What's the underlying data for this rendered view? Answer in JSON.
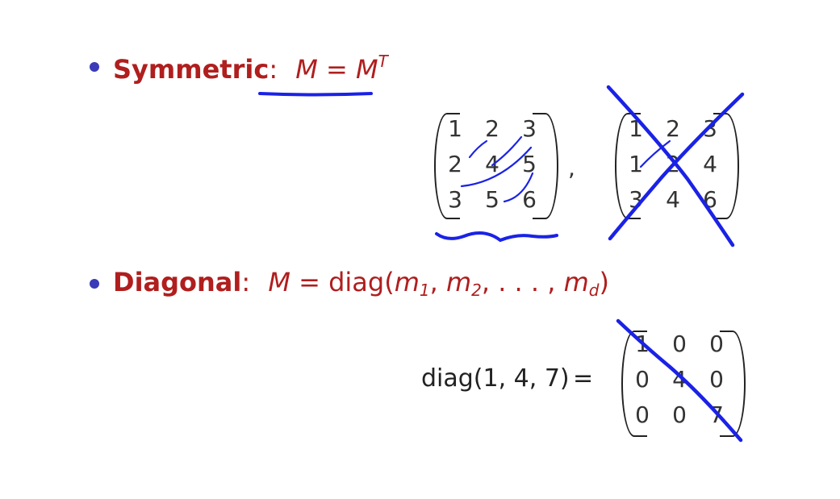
{
  "colors": {
    "heading_red": "#b01e1e",
    "bullet_blue": "#3a3ab8",
    "annotation_blue": "#1a22e6",
    "matrix_text": "#333333"
  },
  "symmetric": {
    "label": "Symmetric",
    "colon": ":",
    "definition": {
      "lhs": "M",
      "eq": "=",
      "rhs_base": "M",
      "rhs_sup": "T"
    },
    "example_matrix": [
      [
        "1",
        "2",
        "3"
      ],
      [
        "2",
        "4",
        "5"
      ],
      [
        "3",
        "5",
        "6"
      ]
    ],
    "separator": ",",
    "counterexample_matrix": [
      [
        "1",
        "2",
        "3"
      ],
      [
        "1",
        "2",
        "4"
      ],
      [
        "3",
        "4",
        "6"
      ]
    ]
  },
  "diagonal": {
    "label": "Diagonal",
    "colon": ":",
    "definition": {
      "lhs": "M",
      "eq": "=",
      "func": "diag(",
      "m1": "m",
      "m1_sub": "1",
      "sep1": ", ",
      "m2": "m",
      "m2_sub": "2",
      "sep2": ", . . . , ",
      "md": "m",
      "md_sub": "d",
      "close": ")"
    },
    "example_lhs": "diag(1, 4, 7)",
    "example_eq": "=",
    "example_matrix": [
      [
        "1",
        "0",
        "0"
      ],
      [
        "0",
        "4",
        "0"
      ],
      [
        "0",
        "0",
        "7"
      ]
    ]
  },
  "annotations": [
    "underline-symmetric-definition",
    "symmetry-arcs-example",
    "squiggle-under-example",
    "cross-out-counterexample",
    "diagonal-slash"
  ]
}
